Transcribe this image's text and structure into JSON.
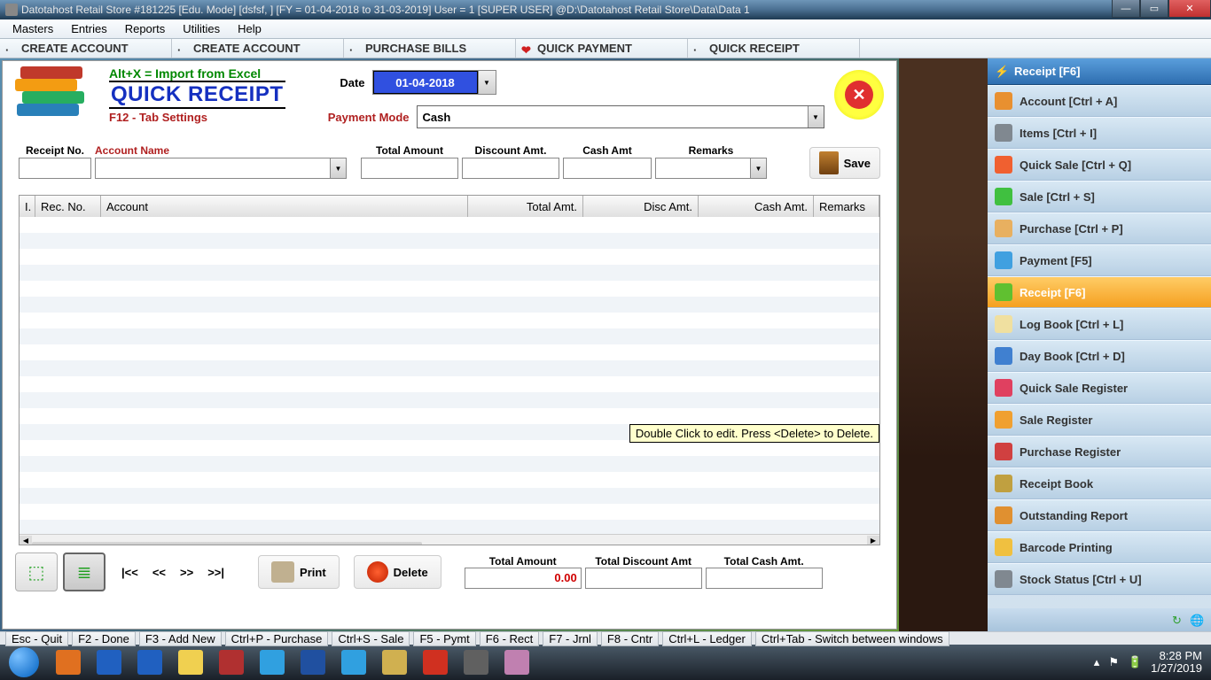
{
  "window": {
    "title": "Datotahost Retail Store #181225  [Edu. Mode]  [dsfsf, ] [FY = 01-04-2018 to 31-03-2019] User = 1 [SUPER USER]  @D:\\Datotahost Retail Store\\Data\\Data 1"
  },
  "menubar": [
    "Masters",
    "Entries",
    "Reports",
    "Utilities",
    "Help"
  ],
  "toolbar": [
    {
      "label": "CREATE ACCOUNT",
      "icon": "account-icon"
    },
    {
      "label": "CREATE ACCOUNT",
      "icon": "account-icon"
    },
    {
      "label": "PURCHASE BILLS",
      "icon": "bills-icon"
    },
    {
      "label": "QUICK PAYMENT",
      "icon": "heart-icon",
      "iconColor": "#d02020"
    },
    {
      "label": "QUICK RECEIPT",
      "icon": "receipt-icon"
    }
  ],
  "form": {
    "importHint": "Alt+X =  Import from Excel",
    "title": "QUICK RECEIPT",
    "f12": "F12 - Tab Settings",
    "dateLabel": "Date",
    "dateValue": "01-04-2018",
    "paymentModeLabel": "Payment Mode",
    "paymentModeValue": "Cash",
    "closeX": "✕",
    "fields": {
      "receiptNo": "Receipt No.",
      "accountName": "Account Name",
      "totalAmount": "Total Amount",
      "discountAmt": "Discount Amt.",
      "cashAmt": "Cash Amt",
      "remarks": "Remarks"
    },
    "saveLabel": "Save",
    "gridColumns": [
      "I.",
      "Rec. No.",
      "Account",
      "Total Amt.",
      "Disc Amt.",
      "Cash Amt.",
      "Remarks"
    ],
    "tooltip": "Double Click to edit.  Press <Delete> to Delete.",
    "bottom": {
      "first": "|<<",
      "prev": "<<",
      "next": ">>",
      "last": ">>|",
      "print": "Print",
      "del": "Delete",
      "totals": {
        "totalAmountLabel": "Total Amount",
        "totalAmount": "0.00",
        "totalDiscountLabel": "Total Discount Amt",
        "totalDiscount": "",
        "totalCashLabel": "Total Cash Amt.",
        "totalCash": ""
      }
    }
  },
  "sidePanel": {
    "header": "Receipt [F6]",
    "items": [
      {
        "label": "Account [Ctrl + A]",
        "icon": "#e89030"
      },
      {
        "label": "Items [Ctrl + I]",
        "icon": "#808890"
      },
      {
        "label": "Quick Sale [Ctrl + Q]",
        "icon": "#f06030"
      },
      {
        "label": "Sale [Ctrl + S]",
        "icon": "#40c040"
      },
      {
        "label": "Purchase [Ctrl + P]",
        "icon": "#e8b060"
      },
      {
        "label": "Payment [F5]",
        "icon": "#40a0e0"
      },
      {
        "label": "Receipt [F6]",
        "icon": "#60c030",
        "active": true
      },
      {
        "label": "Log Book [Ctrl + L]",
        "icon": "#f0e0a0"
      },
      {
        "label": "Day Book [Ctrl + D]",
        "icon": "#4080d0"
      },
      {
        "label": "Quick Sale Register",
        "icon": "#e04060"
      },
      {
        "label": "Sale Register",
        "icon": "#f0a030"
      },
      {
        "label": "Purchase Register",
        "icon": "#d04040"
      },
      {
        "label": "Receipt Book",
        "icon": "#c0a040"
      },
      {
        "label": "Outstanding Report",
        "icon": "#e09030"
      },
      {
        "label": "Barcode Printing",
        "icon": "#f0c040"
      },
      {
        "label": "Stock Status [Ctrl + U]",
        "icon": "#808890"
      }
    ]
  },
  "hints": [
    "Esc - Quit",
    "F2 - Done",
    "F3 - Add New",
    "Ctrl+P - Purchase",
    "Ctrl+S - Sale",
    "F5 - Pymt",
    "F6 - Rect",
    "F7 - Jrnl",
    "F8 - Cntr",
    "Ctrl+L - Ledger",
    "Ctrl+Tab - Switch between windows"
  ],
  "taskbar": {
    "time": "8:28 PM",
    "date": "1/27/2019",
    "apps": [
      "#e07020",
      "#2060c0",
      "#2060c0",
      "#f0d050",
      "#b03030",
      "#30a0e0",
      "#2050a0",
      "#30a0e0",
      "#d0b050",
      "#d03020",
      "#606060",
      "#c080b0"
    ]
  }
}
